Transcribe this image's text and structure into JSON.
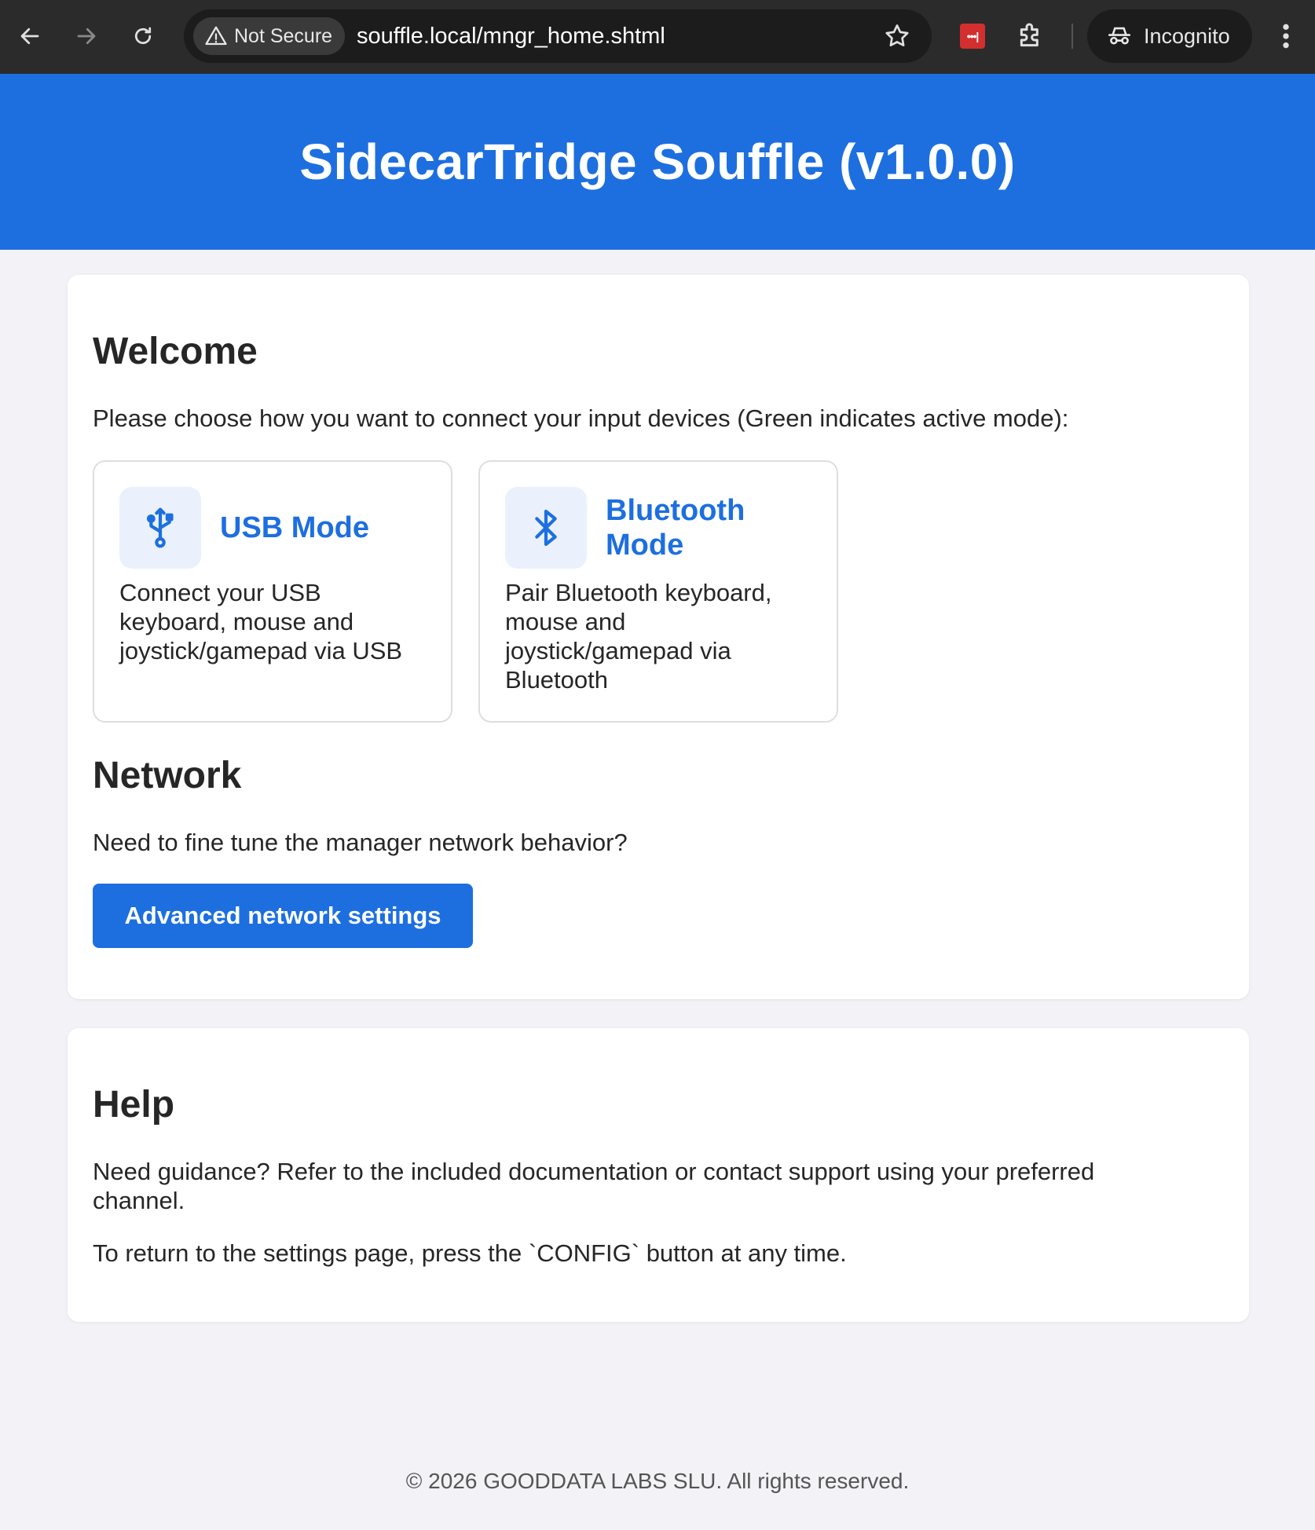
{
  "browser": {
    "security_label": "Not Secure",
    "url": "souffle.local/mngr_home.shtml",
    "incognito_label": "Incognito",
    "password_ext_glyph": "•••|"
  },
  "header": {
    "title": "SidecarTridge Souffle (v1.0.0)"
  },
  "welcome": {
    "heading": "Welcome",
    "intro": "Please choose how you want to connect your input devices (Green indicates active mode):",
    "modes": [
      {
        "title": "USB Mode",
        "description": "Connect your USB keyboard, mouse and joystick/gamepad via USB",
        "icon": "usb-icon"
      },
      {
        "title": "Bluetooth Mode",
        "description": "Pair Bluetooth keyboard, mouse and joystick/gamepad via Bluetooth",
        "icon": "bluetooth-icon"
      }
    ]
  },
  "network": {
    "heading": "Network",
    "text": "Need to fine tune the manager network behavior?",
    "button_label": "Advanced network settings"
  },
  "help": {
    "heading": "Help",
    "text1": "Need guidance? Refer to the included documentation or contact support using your preferred channel.",
    "text2": "To return to the settings page, press the `CONFIG` button at any time."
  },
  "footer": {
    "text": "© 2026 GOODDATA LABS SLU. All rights reserved."
  },
  "colors": {
    "accent": "#1d6fe0",
    "page_bg": "#f2f2f7",
    "chrome_bg": "#2b2b2b"
  }
}
